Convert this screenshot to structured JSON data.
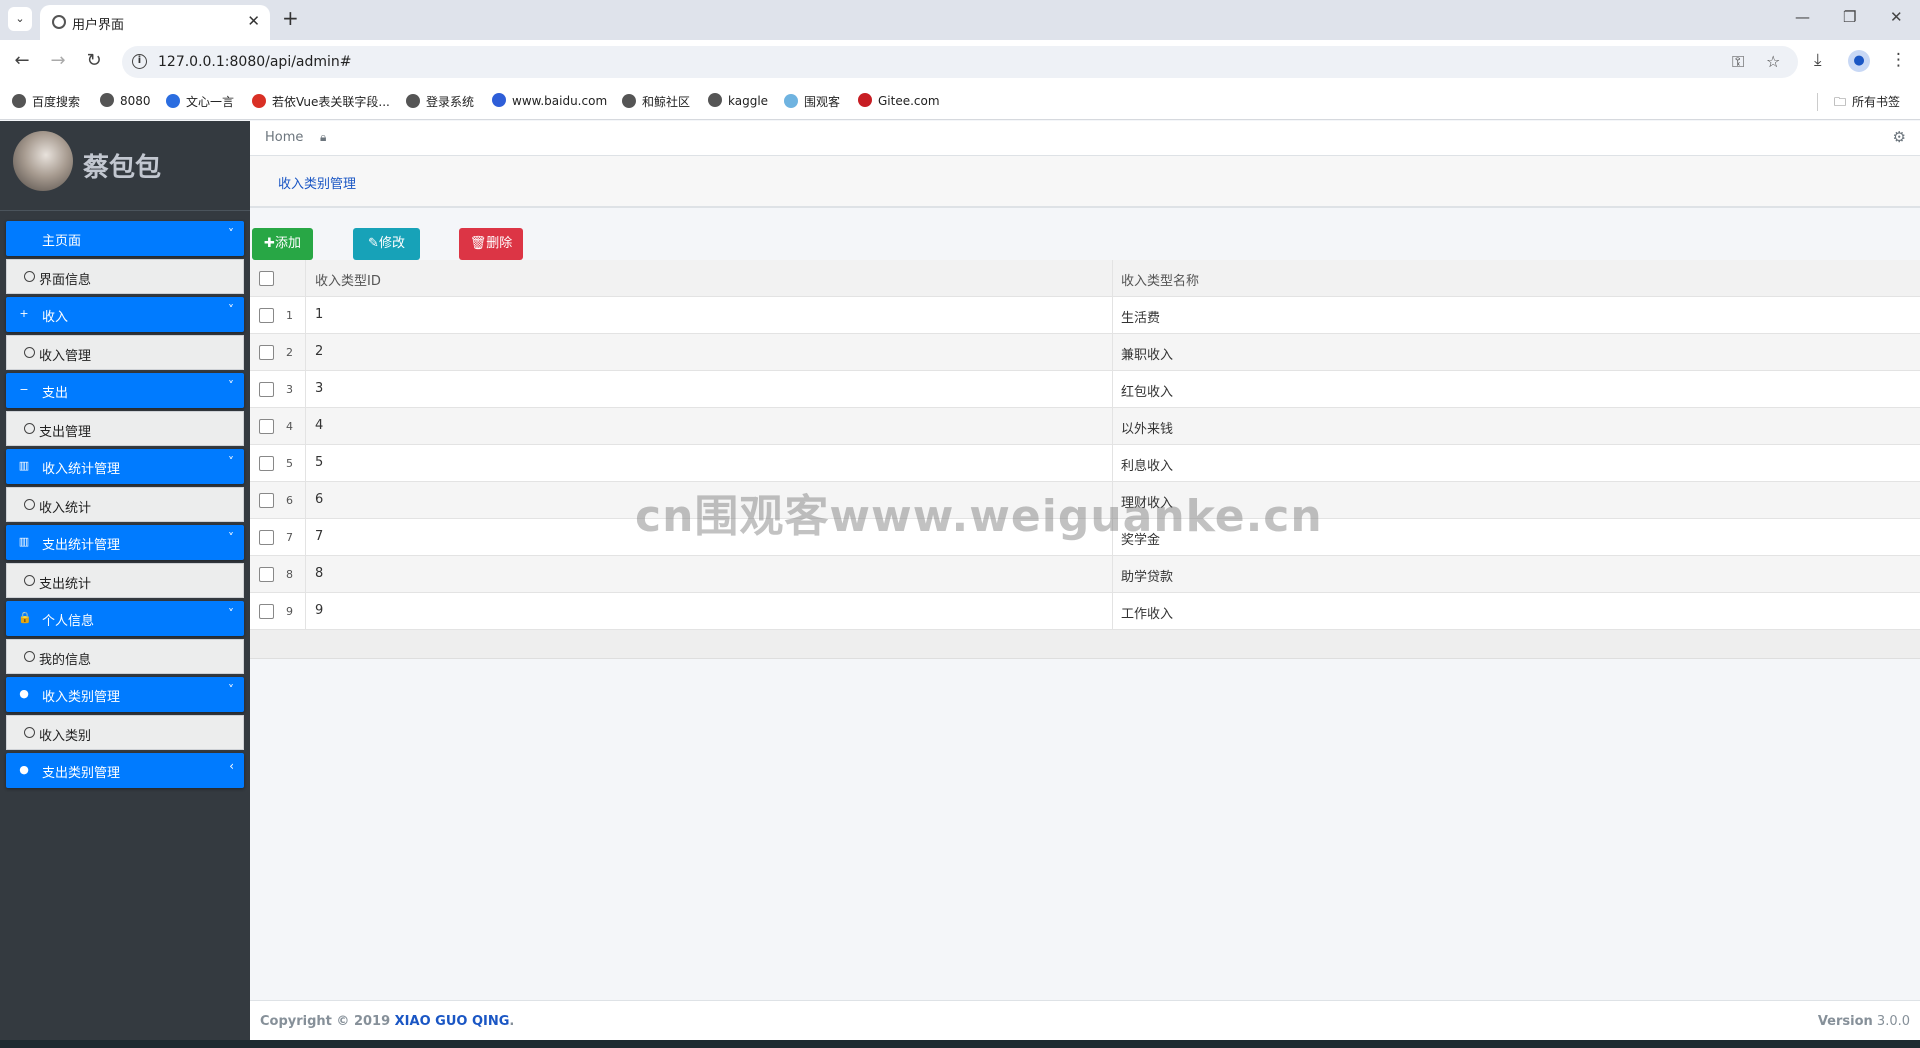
{
  "browser": {
    "tab_title": "用户界面",
    "url": "127.0.0.1:8080/api/admin#",
    "bookmarks": [
      {
        "label": "百度搜索",
        "icon": "globe-icon",
        "color": "#555555"
      },
      {
        "label": "8080",
        "icon": "globe-icon",
        "color": "#555555"
      },
      {
        "label": "文心一言",
        "icon": "wenxin-icon",
        "color": "#2b6de0"
      },
      {
        "label": "若依Vue表关联字段...",
        "icon": "jian-icon",
        "color": "#d93025"
      },
      {
        "label": "登录系统",
        "icon": "globe-icon",
        "color": "#555555"
      },
      {
        "label": "www.baidu.com",
        "icon": "baidu-paw-icon",
        "color": "#2e5ed8"
      },
      {
        "label": "和鲸社区",
        "icon": "globe-icon",
        "color": "#555555"
      },
      {
        "label": "kaggle",
        "icon": "globe-icon",
        "color": "#555555"
      },
      {
        "label": "围观客",
        "icon": "flag-icon",
        "color": "#6fb3e0"
      },
      {
        "label": "Gitee.com",
        "icon": "gitee-icon",
        "color": "#c71d23"
      }
    ],
    "all_bookmarks": "所有书签"
  },
  "sidebar": {
    "user_name": "蔡包包",
    "items": [
      {
        "type": "head",
        "label": "主页面",
        "icon": "apple-icon",
        "glyph": "",
        "chevron": "˅"
      },
      {
        "type": "sub",
        "label": "界面信息"
      },
      {
        "type": "head",
        "label": "收入",
        "icon": "plus-square-icon",
        "glyph": "+",
        "chevron": "˅"
      },
      {
        "type": "sub",
        "label": "收入管理"
      },
      {
        "type": "head",
        "label": "支出",
        "icon": "minus-square-icon",
        "glyph": "−",
        "chevron": "˅"
      },
      {
        "type": "sub",
        "label": "支出管理"
      },
      {
        "type": "head",
        "label": "收入统计管理",
        "icon": "bar-chart-icon",
        "glyph": "▥",
        "chevron": "˅"
      },
      {
        "type": "sub",
        "label": "收入统计"
      },
      {
        "type": "head",
        "label": "支出统计管理",
        "icon": "bar-chart-icon",
        "glyph": "▥",
        "chevron": "˅"
      },
      {
        "type": "sub",
        "label": "支出统计"
      },
      {
        "type": "head",
        "label": "个人信息",
        "icon": "lock-icon",
        "glyph": "🔒",
        "chevron": "˅"
      },
      {
        "type": "sub",
        "label": "我的信息"
      },
      {
        "type": "head",
        "label": "收入类别管理",
        "icon": "circle-icon",
        "glyph": "●",
        "chevron": "˅"
      },
      {
        "type": "sub",
        "label": "收入类别"
      },
      {
        "type": "head",
        "label": "支出类别管理",
        "icon": "circle-icon",
        "glyph": "●",
        "chevron": "‹"
      }
    ]
  },
  "topnav": {
    "home": "Home"
  },
  "content_tab": "收入类别管理",
  "actions": {
    "add": "添加",
    "edit": "修改",
    "delete": "删除"
  },
  "table": {
    "columns": [
      "收入类型ID",
      "收入类型名称"
    ],
    "rows": [
      {
        "idx": "1",
        "id": "1",
        "name": "生活费"
      },
      {
        "idx": "2",
        "id": "2",
        "name": "兼职收入"
      },
      {
        "idx": "3",
        "id": "3",
        "name": "红包收入"
      },
      {
        "idx": "4",
        "id": "4",
        "name": "以外来钱"
      },
      {
        "idx": "5",
        "id": "5",
        "name": "利息收入"
      },
      {
        "idx": "6",
        "id": "6",
        "name": "理财收入"
      },
      {
        "idx": "7",
        "id": "7",
        "name": "奖学金"
      },
      {
        "idx": "8",
        "id": "8",
        "name": "助学贷款"
      },
      {
        "idx": "9",
        "id": "9",
        "name": "工作收入"
      }
    ]
  },
  "watermark": "cn围观客www.weiguanke.cn",
  "footer": {
    "copyright": "Copyright © 2019 ",
    "brand": "XIAO GUO QING",
    "period": ".",
    "version_label": "Version",
    "version": "3.0.0"
  },
  "colors": {
    "sidebar_bg": "#343a40",
    "primary": "#007bff",
    "success": "#28a745",
    "info": "#17a2b8",
    "danger": "#dc3545"
  }
}
